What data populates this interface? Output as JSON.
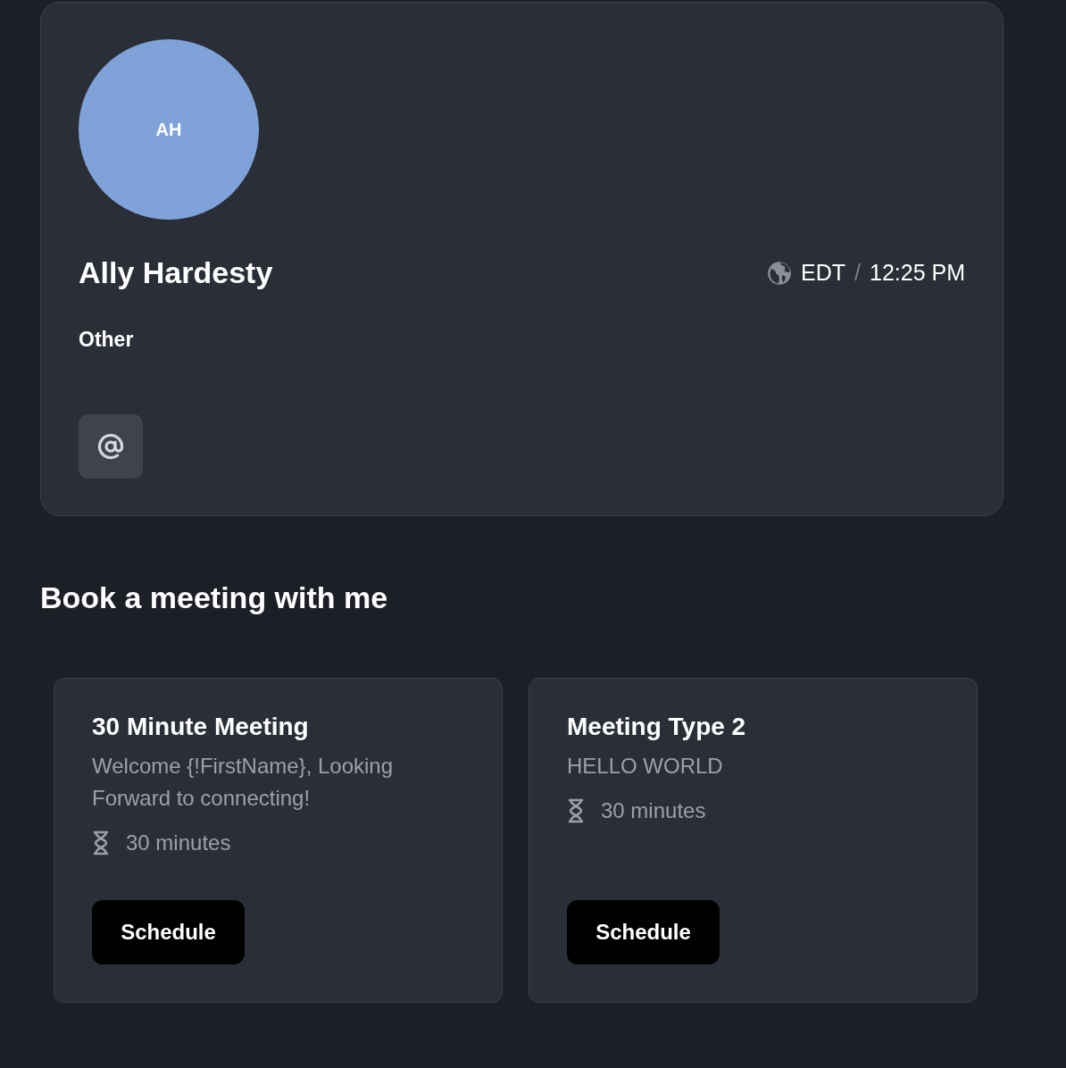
{
  "profile": {
    "initials": "AH",
    "name": "Ally Hardesty",
    "timezone": "EDT",
    "separator": "/",
    "time": "12:25 PM",
    "role": "Other"
  },
  "section_title": "Book a meeting with me",
  "meetings": [
    {
      "title": "30 Minute Meeting",
      "description": "Welcome {!FirstName}, Looking Forward to connecting!",
      "duration": "30 minutes",
      "button": "Schedule"
    },
    {
      "title": "Meeting Type 2",
      "description": "HELLO WORLD",
      "duration": "30 minutes",
      "button": "Schedule"
    }
  ]
}
